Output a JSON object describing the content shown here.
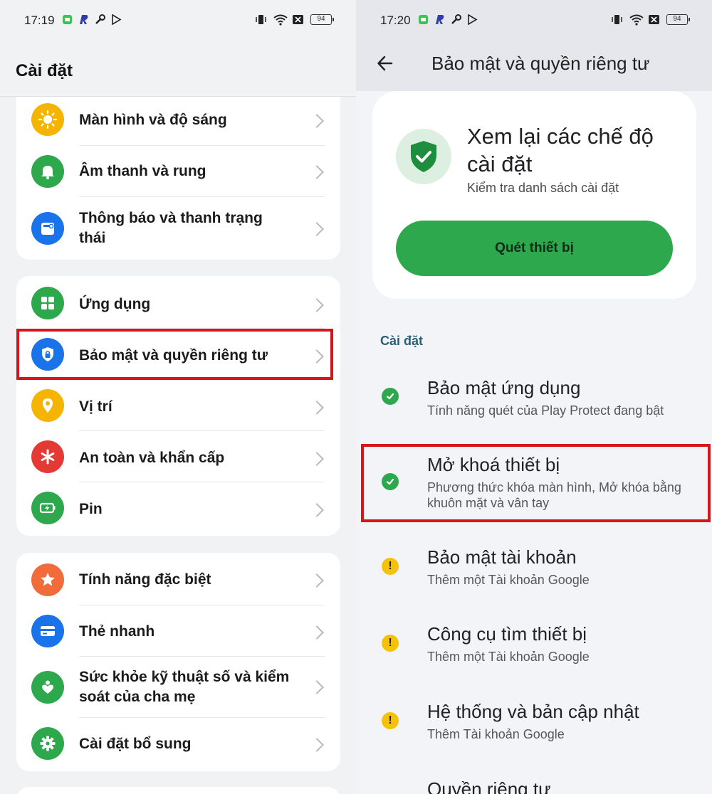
{
  "left": {
    "status": {
      "time": "17:19",
      "battery": "94"
    },
    "title": "Cài đặt",
    "groups": [
      {
        "items": [
          {
            "label": "Màn hình và độ sáng",
            "icon": "sun-icon",
            "color": "#f4b400"
          },
          {
            "label": "Âm thanh và rung",
            "icon": "bell-icon",
            "color": "#2ea84d"
          },
          {
            "label": "Thông báo và thanh trạng thái",
            "icon": "notification-icon",
            "color": "#1a73e8"
          }
        ]
      },
      {
        "items": [
          {
            "label": "Ứng dụng",
            "icon": "apps-grid-icon",
            "color": "#2ea84d"
          },
          {
            "label": "Bảo mật và quyền riêng tư",
            "icon": "shield-lock-icon",
            "color": "#1a73e8"
          },
          {
            "label": "Vị trí",
            "icon": "location-pin-icon",
            "color": "#f4b400"
          },
          {
            "label": "An toàn và khẩn cấp",
            "icon": "asterisk-icon",
            "color": "#e53935"
          },
          {
            "label": "Pin",
            "icon": "battery-icon",
            "color": "#2ea84d"
          }
        ]
      },
      {
        "items": [
          {
            "label": "Tính năng đặc biệt",
            "icon": "star-icon",
            "color": "#f26b3a"
          },
          {
            "label": "Thẻ nhanh",
            "icon": "card-icon",
            "color": "#1a73e8"
          },
          {
            "label": "Sức khỏe kỹ thuật số và kiểm soát của cha mẹ",
            "icon": "heart-person-icon",
            "color": "#2ea84d"
          },
          {
            "label": "Cài đặt bổ sung",
            "icon": "gear-icon",
            "color": "#2ea84d"
          }
        ]
      }
    ]
  },
  "right": {
    "status": {
      "time": "17:20",
      "battery": "94"
    },
    "title": "Bảo mật và quyền riêng tư",
    "hero": {
      "title": "Xem lại các chế độ cài đặt",
      "subtitle": "Kiểm tra danh sách cài đặt",
      "button": "Quét thiết bị"
    },
    "section": "Cài đặt",
    "items": [
      {
        "title": "Bảo mật ứng dụng",
        "subtitle": "Tính năng quét của Play Protect đang bật",
        "status": "ok"
      },
      {
        "title": "Mở khoá thiết bị",
        "subtitle": "Phương thức khóa màn hình, Mở khóa bằng khuôn mặt và vân tay",
        "status": "ok"
      },
      {
        "title": "Bảo mật tài khoản",
        "subtitle": "Thêm một Tài khoản Google",
        "status": "warning"
      },
      {
        "title": "Công cụ tìm thiết bị",
        "subtitle": "Thêm một Tài khoản Google",
        "status": "warning"
      },
      {
        "title": "Hệ thống và bản cập nhật",
        "subtitle": "Thêm Tài khoản Google",
        "status": "warning"
      },
      {
        "title": "Quyền riêng tư",
        "subtitle": "",
        "status": ""
      }
    ]
  },
  "colors": {
    "ok": "#2ea84d",
    "warning": "#f4c20d",
    "highlight": "#d9151c"
  }
}
